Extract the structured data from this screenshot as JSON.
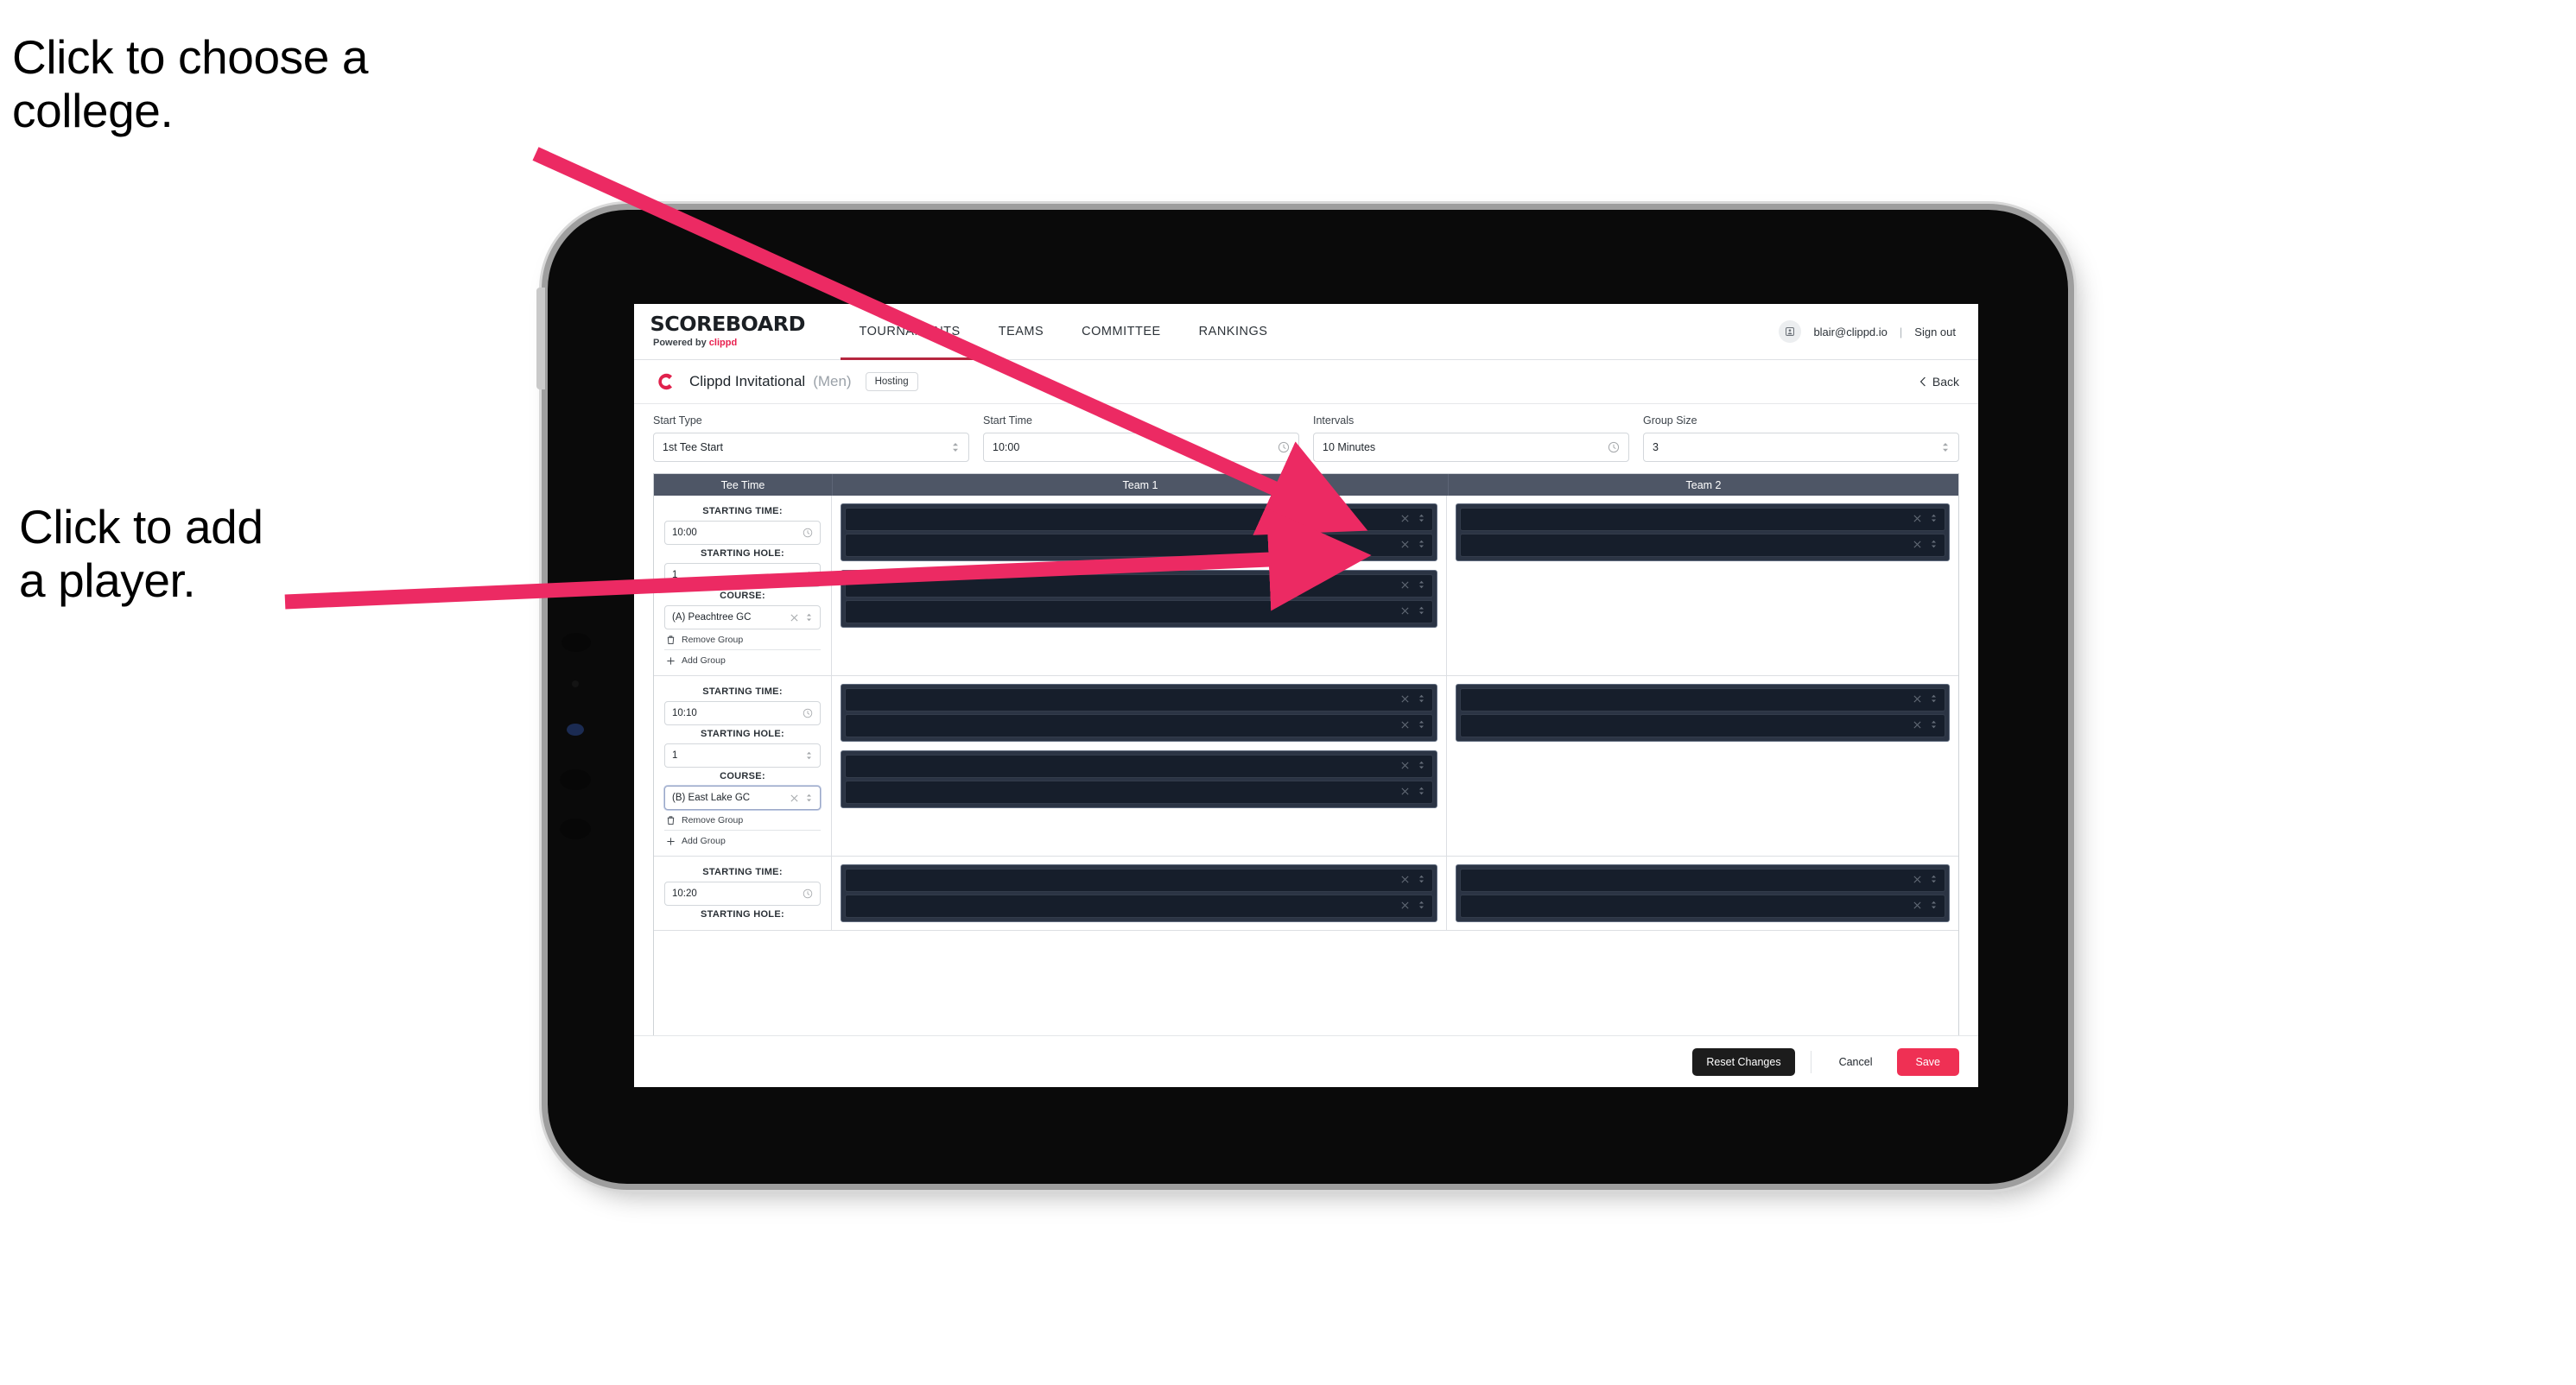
{
  "annotations": [
    {
      "id": "choose-college",
      "text": "Click to choose a\ncollege."
    },
    {
      "id": "add-player",
      "text": "Click to add\na player."
    }
  ],
  "colors": {
    "accent_pink": "#ef3054",
    "brand_red": "#e8204f",
    "table_header": "#4e5666",
    "player_row": "#161e2b",
    "group_box": "#2b3444",
    "arrow": "#ec2a63"
  },
  "app": {
    "topbar": {
      "brand_main": "SCOREBOARD",
      "brand_sub_prefix": "Powered by ",
      "brand_sub_name": "clippd",
      "tabs": [
        {
          "label": "TOURNAMENTS",
          "active": true
        },
        {
          "label": "TEAMS",
          "active": false
        },
        {
          "label": "COMMITTEE",
          "active": false
        },
        {
          "label": "RANKINGS",
          "active": false
        }
      ],
      "user_email": "blair@clippd.io",
      "separator": "|",
      "sign_out": "Sign out"
    },
    "title_row": {
      "logo_letter": "C",
      "tournament_name": "Clippd Invitational",
      "gender": "(Men)",
      "badge": "Hosting",
      "back_label": "Back"
    },
    "form": [
      {
        "label": "Start Type",
        "value": "1st Tee Start",
        "icon": "stepper-icon"
      },
      {
        "label": "Start Time",
        "value": "10:00",
        "icon": "clock-icon"
      },
      {
        "label": "Intervals",
        "value": "10 Minutes",
        "icon": "clock-icon"
      },
      {
        "label": "Group Size",
        "value": "3",
        "icon": "stepper-icon"
      }
    ],
    "table": {
      "headers": [
        "Tee Time",
        "Team 1",
        "Team 2"
      ],
      "field_labels": {
        "starting_time": "STARTING TIME:",
        "starting_hole": "STARTING HOLE:",
        "course": "COURSE:"
      },
      "links": {
        "remove": "Remove Group",
        "add": "Add Group"
      },
      "rows": [
        {
          "starting_time": "10:00",
          "starting_hole": "1",
          "course": "(A) Peachtree GC",
          "course_focused": false,
          "team1_groups": [
            {
              "players": 2
            },
            {
              "players": 2
            }
          ],
          "team2_groups": [
            {
              "players": 2
            }
          ]
        },
        {
          "starting_time": "10:10",
          "starting_hole": "1",
          "course": "(B) East Lake GC",
          "course_focused": true,
          "team1_groups": [
            {
              "players": 2
            },
            {
              "players": 2
            }
          ],
          "team2_groups": [
            {
              "players": 2
            }
          ]
        },
        {
          "starting_time": "10:20",
          "starting_hole": "",
          "course": "",
          "course_focused": false,
          "team1_groups": [
            {
              "players": 2
            }
          ],
          "team2_groups": [
            {
              "players": 2
            }
          ]
        }
      ]
    },
    "footer": {
      "reset": "Reset Changes",
      "cancel": "Cancel",
      "save": "Save"
    }
  }
}
